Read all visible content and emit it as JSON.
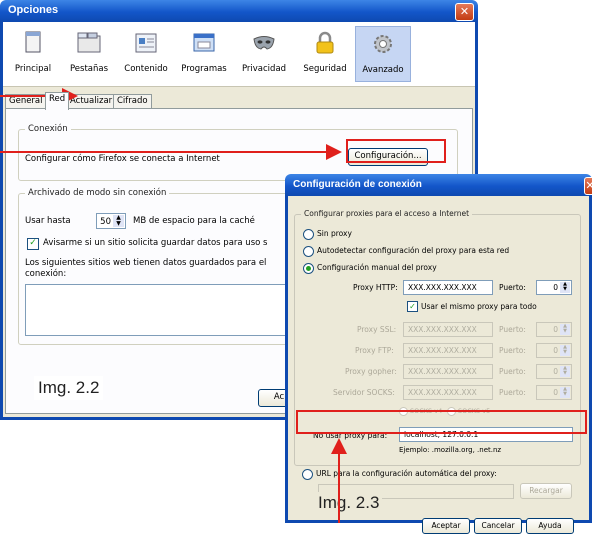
{
  "options_window": {
    "title": "Opciones",
    "toolbar": [
      {
        "label": "Principal",
        "icon": "window-icon"
      },
      {
        "label": "Pestañas",
        "icon": "tabs-icon"
      },
      {
        "label": "Contenido",
        "icon": "content-icon"
      },
      {
        "label": "Programas",
        "icon": "programs-icon"
      },
      {
        "label": "Privacidad",
        "icon": "mask-icon"
      },
      {
        "label": "Seguridad",
        "icon": "lock-icon"
      },
      {
        "label": "Avanzado",
        "icon": "gear-icon",
        "selected": true
      }
    ],
    "tabs": [
      "General",
      "Red",
      "Actualizar",
      "Cifrado"
    ],
    "active_tab": "Red",
    "conexion": {
      "legend": "Conexión",
      "text": "Configurar cómo Firefox se conecta a Internet",
      "button": "Configuración..."
    },
    "offline": {
      "legend": "Archivado de modo sin conexión",
      "use_up_to": "Usar hasta",
      "cache_value": "50",
      "cache_suffix": "MB de espacio para la caché",
      "notify_label": "Avisarme si un sitio solicita guardar datos para uso s",
      "notify_checked": true,
      "sites_text_1": "Los siguientes sitios web tienen datos guardados para el",
      "sites_text_2": "conexión:"
    },
    "img_label": "Img. 2.2",
    "partial_button": "Ac"
  },
  "connection_window": {
    "title": "Configuración de conexión",
    "group_legend": "Configurar proxies para el acceso a Internet",
    "radio_none": "Sin proxy",
    "radio_auto": "Autodetectar configuración del proxy para esta red",
    "radio_manual": "Configuración manual del proxy",
    "selected_radio": "manual",
    "http_label": "Proxy HTTP:",
    "http_value": "XXX.XXX.XXX.XXX",
    "port_label": "Puerto:",
    "http_port": "0",
    "same_proxy_label": "Usar el mismo proxy para todo",
    "same_proxy_checked": true,
    "disabled_rows": [
      {
        "label": "Proxy SSL:",
        "value": "XXX.XXX.XXX.XXX",
        "port_label": "Puerto:",
        "port": "0"
      },
      {
        "label": "Proxy FTP:",
        "value": "XXX.XXX.XXX.XXX",
        "port_label": "Puerto:",
        "port": "0"
      },
      {
        "label": "Proxy gopher:",
        "value": "XXX.XXX.XXX.XXX",
        "port_label": "Puerto:",
        "port": "0"
      },
      {
        "label": "Servidor SOCKS:",
        "value": "XXX.XXX.XXX.XXX",
        "port_label": "Puerto:",
        "port": "0"
      }
    ],
    "socks_v4": "SOCKS v4",
    "socks_v5": "SOCKS v5",
    "no_proxy_label": "No usar proxy para:",
    "no_proxy_value": "localhost, 127.0.0.1",
    "example_text": "Ejemplo: .mozilla.org, .net.nz",
    "radio_url": "URL para la configuración automática del proxy:",
    "reload_button": "Recargar",
    "accept_button": "Aceptar",
    "cancel_button": "Cancelar",
    "help_button": "Ayuda",
    "img_label": "Img. 2.3"
  },
  "colors": {
    "annotation_red": "#e0201c",
    "xp_title_blue": "#1356c9",
    "dialog_bg": "#ece9d8"
  }
}
